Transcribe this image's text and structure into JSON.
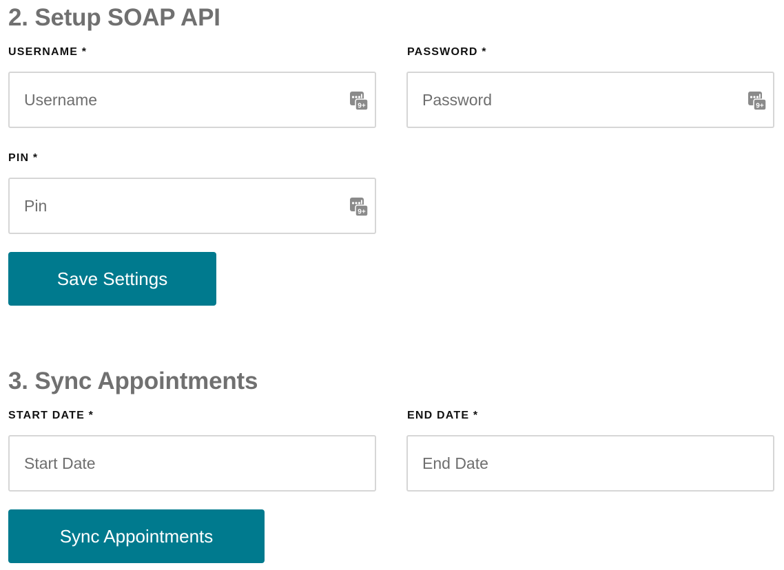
{
  "soap_section": {
    "title": "2. Setup SOAP API",
    "username": {
      "label": "USERNAME *",
      "placeholder": "Username",
      "value": ""
    },
    "password": {
      "label": "PASSWORD *",
      "placeholder": "Password",
      "value": ""
    },
    "pin": {
      "label": "PIN *",
      "placeholder": "Pin",
      "value": ""
    },
    "field_icon": "numeric-keypad-icon",
    "field_icon_badge": "9+",
    "save_button_label": "Save Settings"
  },
  "sync_section": {
    "title": "3. Sync Appointments",
    "start_date": {
      "label": "START DATE *",
      "placeholder": "Start Date",
      "value": ""
    },
    "end_date": {
      "label": "END DATE *",
      "placeholder": "End Date",
      "value": ""
    },
    "sync_button_label": "Sync Appointments"
  },
  "colors": {
    "button_bg": "#007a8e",
    "button_text": "#ffffff",
    "title_text": "#707070",
    "label_text": "#111111",
    "field_border": "#d6d6d6",
    "placeholder_text": "#6e6e6e",
    "icon_gray": "#8a8a8a"
  }
}
